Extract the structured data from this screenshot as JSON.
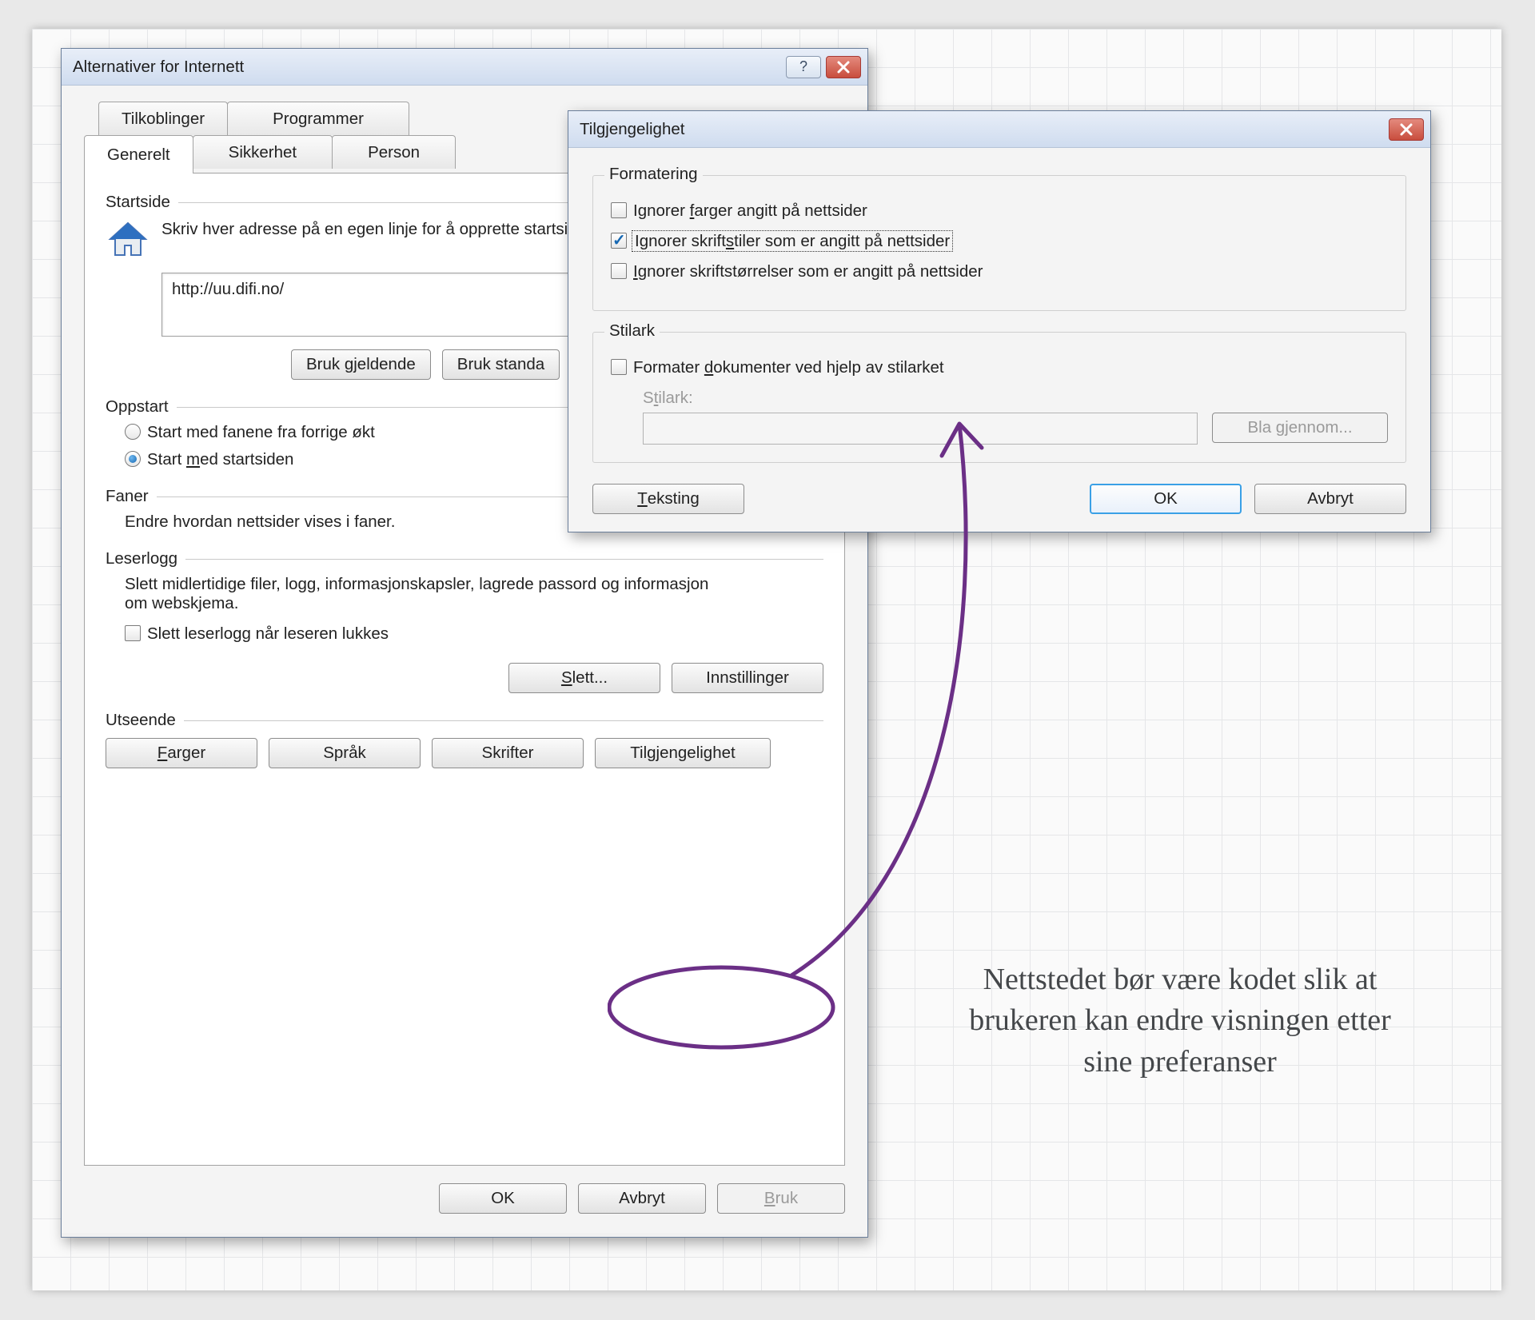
{
  "mainDialog": {
    "title": "Alternativer for Internett",
    "tabsBack": [
      "Tilkoblinger",
      "Programmer"
    ],
    "tabsFront": [
      "Generelt",
      "Sikkerhet",
      "Person"
    ],
    "selectedTab": "Generelt",
    "startside": {
      "header": "Startside",
      "desc": "Skriv hver adresse på en egen linje for å opprette startsidefaner.",
      "url": "http://uu.difi.no/",
      "btn1": "Bruk gjeldende",
      "btn2": "Bruk standa"
    },
    "oppstart": {
      "header": "Oppstart",
      "opt1": "Start med fanene fra forrige økt",
      "opt2": "Start med startsiden"
    },
    "faner": {
      "header": "Faner",
      "desc": "Endre hvordan nettsider vises i faner."
    },
    "leserlogg": {
      "header": "Leserlogg",
      "desc": "Slett midlertidige filer, logg, informasjonskapsler, lagrede passord og informasjon om webskjema.",
      "cb": "Slett leserlogg når leseren lukkes",
      "btnSlett": "Slett...",
      "btnInnst": "Innstillinger"
    },
    "utseende": {
      "header": "Utseende",
      "b1": "Farger",
      "b2": "Språk",
      "b3": "Skrifter",
      "b4": "Tilgjengelighet"
    },
    "footer": {
      "ok": "OK",
      "avbryt": "Avbryt",
      "bruk": "Bruk"
    }
  },
  "accDialog": {
    "title": "Tilgjengelighet",
    "formatering": {
      "legend": "Formatering",
      "cb1": "Ignorer farger angitt på nettsider",
      "cb2": "Ignorer skriftstiler som er angitt på nettsider",
      "cb3": "Ignorer skriftstørrelser som er angitt på nettsider"
    },
    "stilark": {
      "legend": "Stilark",
      "cb": "Formater dokumenter ved hjelp av stilarket",
      "label": "Stilark:",
      "browse": "Bla gjennom..."
    },
    "footer": {
      "teksting": "Teksting",
      "ok": "OK",
      "avbryt": "Avbryt"
    }
  },
  "note": "Nettstedet bør være kodet slik at brukeren kan endre visningen etter sine preferanser"
}
